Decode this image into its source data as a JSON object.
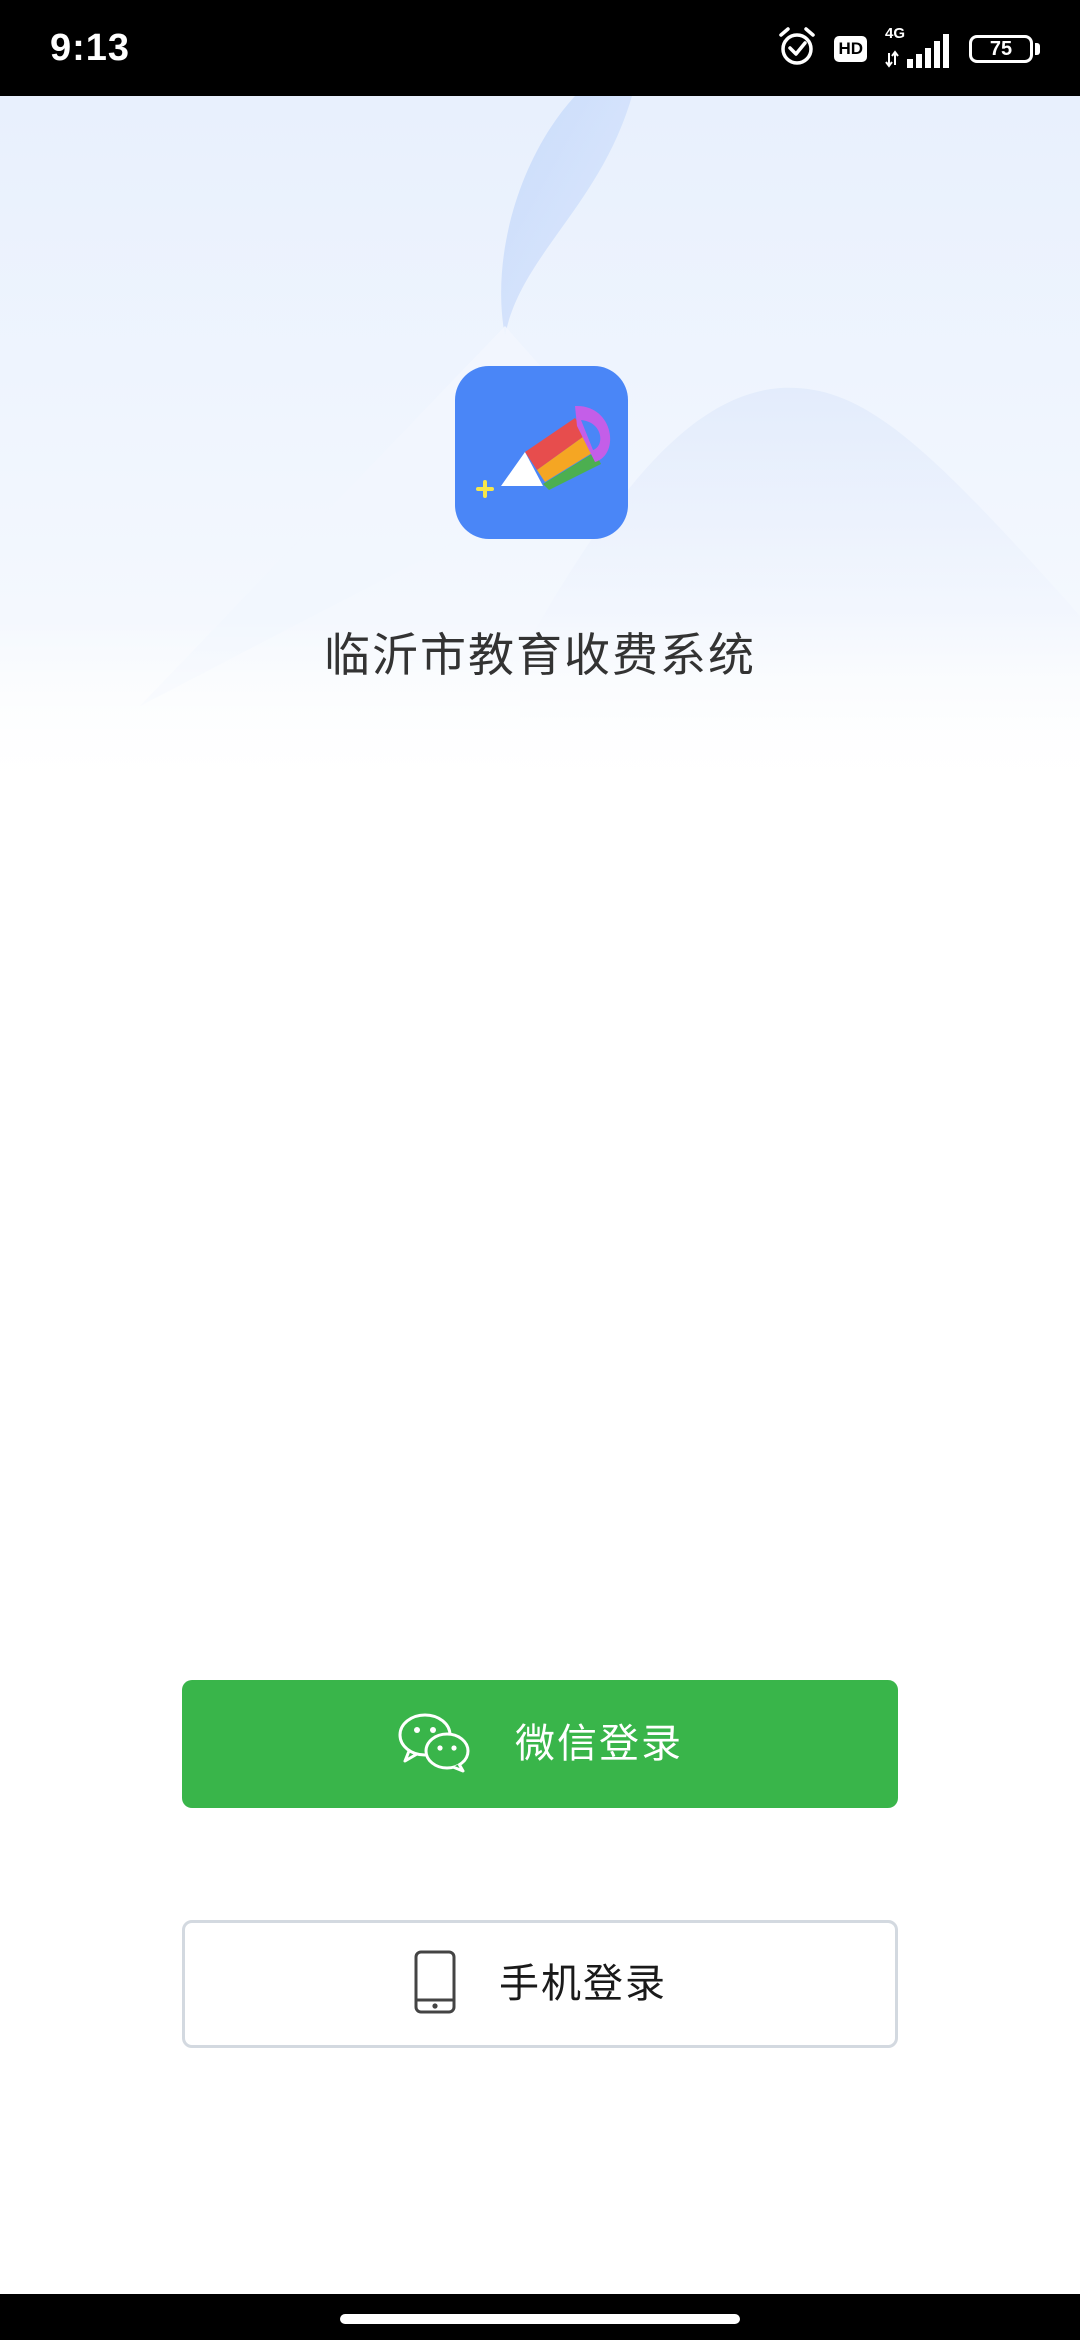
{
  "status_bar": {
    "time": "9:13",
    "hd_label": "HD",
    "network_label": "4G",
    "battery_level": "75",
    "icons": [
      "alarm-icon",
      "hd-icon",
      "signal-icon",
      "battery-icon"
    ]
  },
  "app": {
    "name": "临沂市教育收费系统",
    "logo_icon": "pencil-logo-icon",
    "logo_color": "#4a86f7"
  },
  "login": {
    "wechat_label": "微信登录",
    "wechat_icon": "wechat-icon",
    "wechat_color": "#39b54a",
    "phone_label": "手机登录",
    "phone_icon": "mobile-phone-icon"
  }
}
